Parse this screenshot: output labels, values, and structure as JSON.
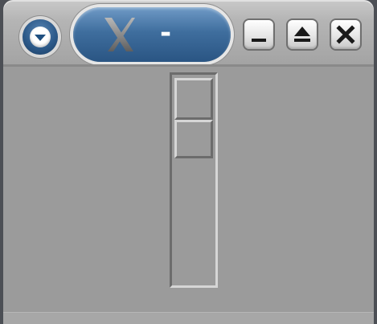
{
  "window": {
    "title_text": "-",
    "app_icon": "x-logo-icon",
    "menu_icon": "chevron-down-icon"
  },
  "titlebar": {
    "buttons": [
      "minimize",
      "maximize",
      "close"
    ]
  },
  "colors": {
    "titlebar_pill": "#3f6e9e",
    "content_bg": "#9b9b9b",
    "button_glyph": "#1a1a1a"
  },
  "scrollbar": {
    "orientation": "vertical",
    "position_fraction": 0.0
  }
}
